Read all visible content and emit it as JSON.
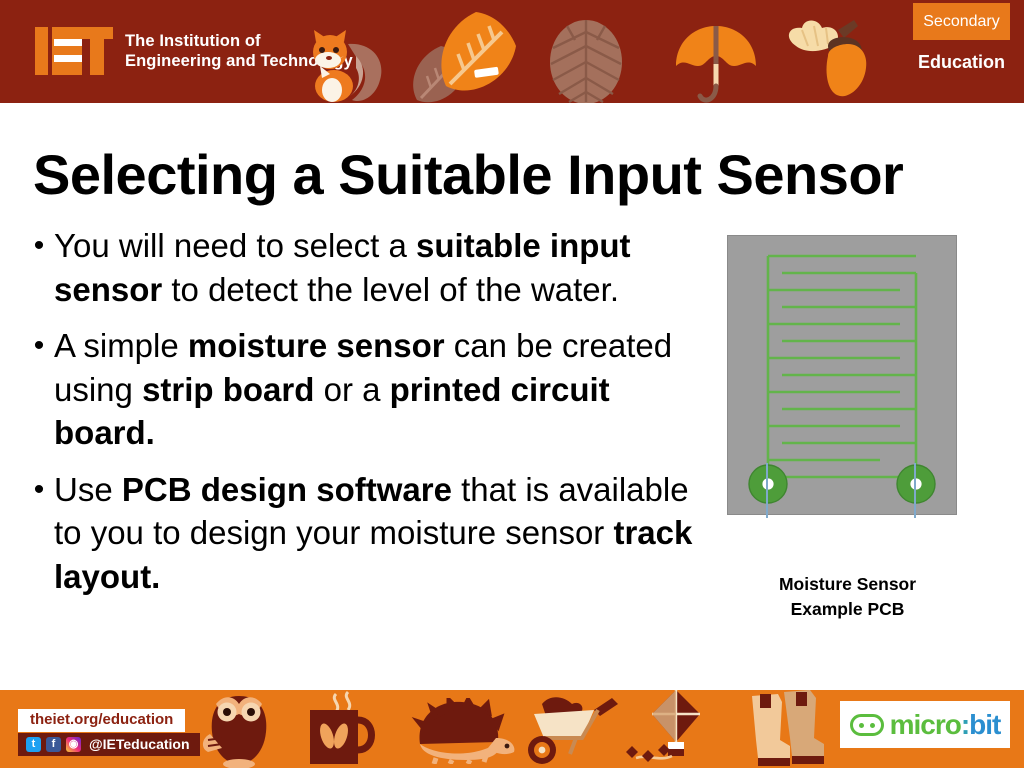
{
  "header": {
    "logo_name": "iet-logo",
    "logo_text": "The Institution of\nEngineering and Technology",
    "badge_label": "Secondary",
    "education_label": "Education",
    "brand_red": "#8C2211",
    "brand_orange": "#E8791B",
    "decorative_icons": [
      "squirrel-icon",
      "brown-leaf-icon",
      "orange-leaf-icon",
      "pine-cone-icon",
      "umbrella-icon",
      "acorn-icon"
    ]
  },
  "slide": {
    "title": "Selecting a Suitable Input Sensor",
    "bullets": [
      {
        "marker": "•",
        "segments": [
          {
            "text": "You will need to select a ",
            "bold": false
          },
          {
            "text": "suitable input sensor",
            "bold": true
          },
          {
            "text": " to detect the level of the water.",
            "bold": false
          }
        ]
      },
      {
        "marker": "•",
        "segments": [
          {
            "text": "A simple ",
            "bold": false
          },
          {
            "text": "moisture sensor",
            "bold": true
          },
          {
            "text": " can be created using ",
            "bold": false
          },
          {
            "text": "strip board",
            "bold": true
          },
          {
            "text": " or a ",
            "bold": false
          },
          {
            "text": "printed circuit board.",
            "bold": true
          }
        ]
      },
      {
        "marker": "•",
        "segments": [
          {
            "text": "Use ",
            "bold": false
          },
          {
            "text": "PCB design software",
            "bold": true
          },
          {
            "text": " that is available to you to design your moisture sensor ",
            "bold": false
          },
          {
            "text": "track layout.",
            "bold": true
          }
        ]
      }
    ]
  },
  "figure": {
    "name": "moisture-sensor-pcb-diagram",
    "caption": "Moisture Sensor\nExample PCB",
    "board_color": "#9E9E9E",
    "track_color": "#63B44B",
    "pad_color": "#4E9D3A",
    "pad_hole_color": "#FFFFFF",
    "lead_color": "#7FA9CB",
    "pad_count": 2,
    "track_fingers": 11
  },
  "footer": {
    "url": "theiet.org/education",
    "social_handle": "@IETeducation",
    "social_icons": [
      "twitter-icon",
      "facebook-icon",
      "instagram-icon"
    ],
    "microbit_text_parts": [
      "micro",
      ":",
      "bit"
    ],
    "microbit_logo_name": "microbit-logo",
    "footer_orange": "#E87817",
    "footer_dark": "#6E1A0E",
    "decorative_icons": [
      "owl-icon",
      "mug-icon",
      "hedgehog-icon",
      "wheelbarrow-icon",
      "kite-icon",
      "boots-icon"
    ]
  }
}
